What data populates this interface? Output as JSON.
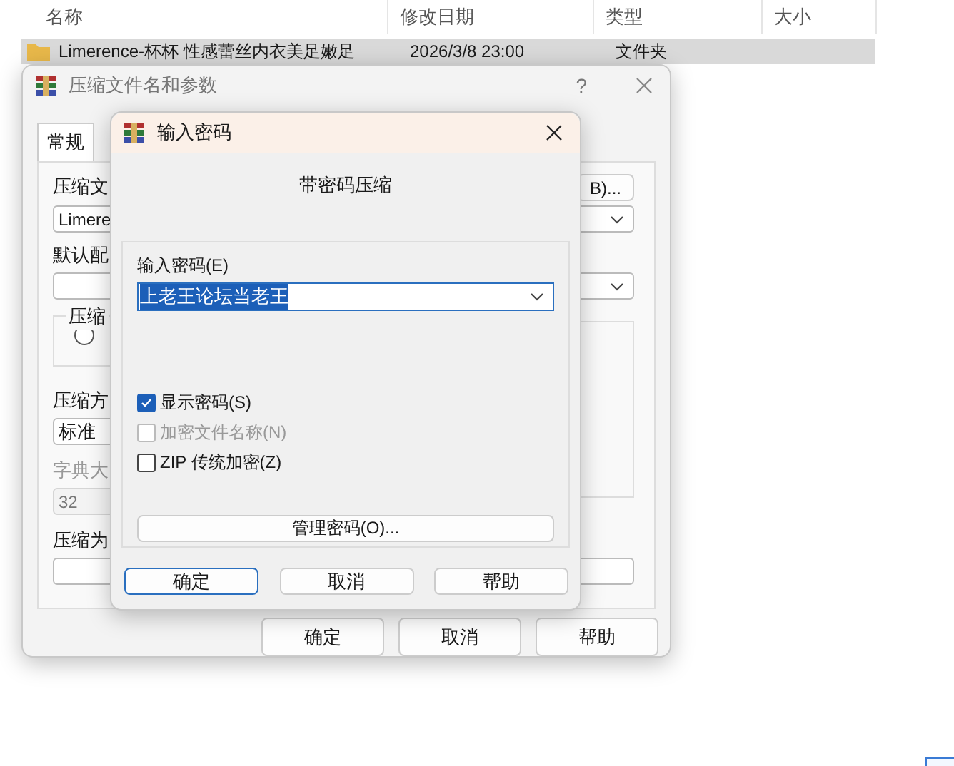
{
  "explorer": {
    "columns": [
      "名称",
      "修改日期",
      "类型",
      "大小"
    ],
    "rows": [
      {
        "name": "Limerence-杯杯 性感蕾丝内衣美足嫩足",
        "modified": "2026/3/8 23:00",
        "type": "文件夹",
        "selected": true
      }
    ]
  },
  "back_dialog": {
    "title": "压缩文件名和参数",
    "help": "?",
    "tabs": [
      {
        "label": "常规",
        "selected": true
      }
    ],
    "archive_label": "压缩文",
    "browse_button": "B)...",
    "archive_name": "Limere",
    "profile_label": "默认配",
    "format_group": "压缩",
    "format_radio": {
      "checked": false
    },
    "method_label": "压缩方",
    "method": "标准",
    "dict_label": "字典大",
    "dict_size": "32",
    "dict_disabled": true,
    "split_label": "压缩为",
    "buttons": [
      "确定",
      "取消",
      "帮助"
    ]
  },
  "password_dialog": {
    "title": "输入密码",
    "heading": "带密码压缩",
    "password_label": "输入密码(E)",
    "password": "上老王论坛当老王",
    "options": [
      {
        "label": "显示密码(S)",
        "checked": true,
        "disabled": false
      },
      {
        "label": "加密文件名称(N)",
        "checked": false,
        "disabled": true
      },
      {
        "label": "ZIP 传统加密(Z)",
        "checked": false,
        "disabled": false
      }
    ],
    "manage_button": "管理密码(O)...",
    "buttons": [
      {
        "label": "确定",
        "default": true
      },
      {
        "label": "取消",
        "default": false
      },
      {
        "label": "帮助",
        "default": false
      }
    ]
  }
}
